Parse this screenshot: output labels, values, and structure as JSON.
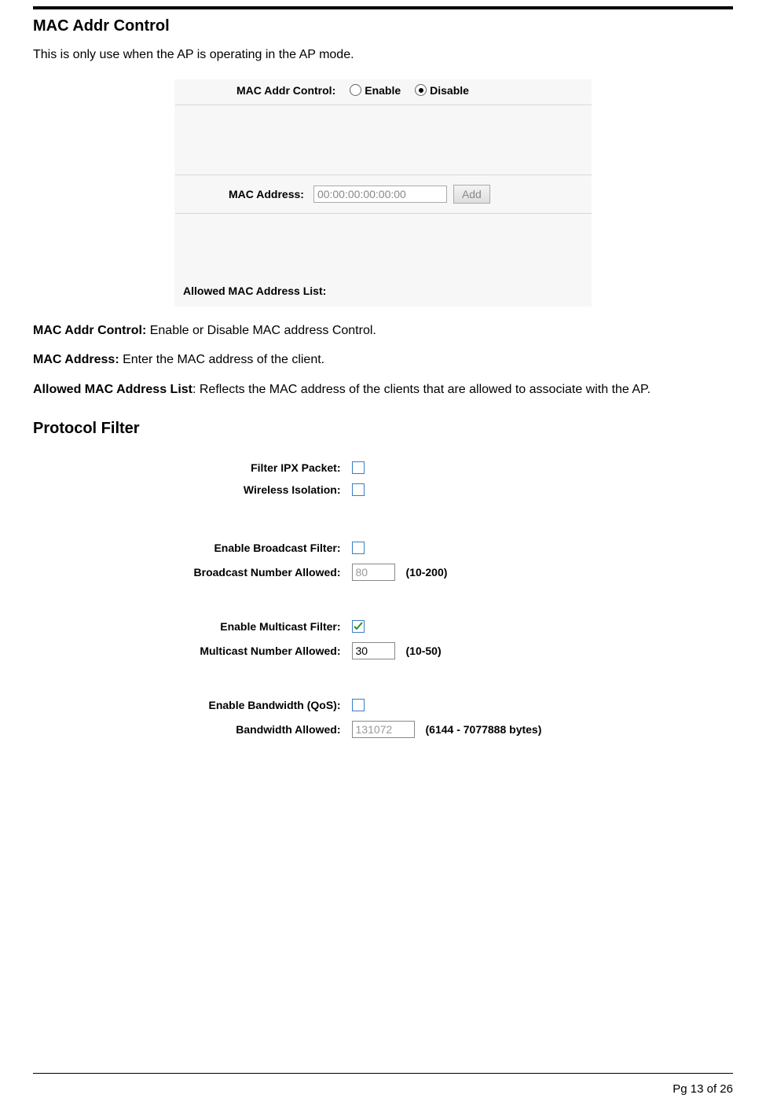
{
  "section1": {
    "title": "MAC Addr Control",
    "intro": "This is only use when the AP is operating in the AP mode."
  },
  "macUi": {
    "controlLabel": "MAC Addr Control:",
    "enableLabel": "Enable",
    "disableLabel": "Disable",
    "addrLabel": "MAC Address:",
    "addrPlaceholder": "00:00:00:00:00:00",
    "addBtn": "Add",
    "allowedLabel": "Allowed MAC Address List:"
  },
  "desc": {
    "macControlLabel": "MAC Addr Control: ",
    "macControlText": "Enable or Disable MAC address Control.",
    "macAddrLabel": "MAC Address: ",
    "macAddrText": "Enter the MAC address of the client.",
    "allowedLabel": "Allowed MAC Address List",
    "allowedText": ": Reflects the MAC address of the clients that are allowed to associate with the AP."
  },
  "section2": {
    "title": "Protocol Filter"
  },
  "pf": {
    "filterIpx": "Filter IPX Packet:",
    "wirelessIso": "Wireless Isolation:",
    "enableBroadcast": "Enable Broadcast Filter:",
    "broadcastNum": "Broadcast Number Allowed:",
    "broadcastVal": "80",
    "broadcastHint": "(10-200)",
    "enableMulticast": "Enable Multicast Filter:",
    "multicastNum": "Multicast Number Allowed:",
    "multicastVal": "30",
    "multicastHint": "(10-50)",
    "enableQos": "Enable Bandwidth (QoS):",
    "bandwidthAllowed": "Bandwidth Allowed:",
    "bandwidthVal": "131072",
    "bandwidthHint": "(6144 - 7077888 bytes)"
  },
  "footer": {
    "pageText": "Pg 13 of 26"
  }
}
